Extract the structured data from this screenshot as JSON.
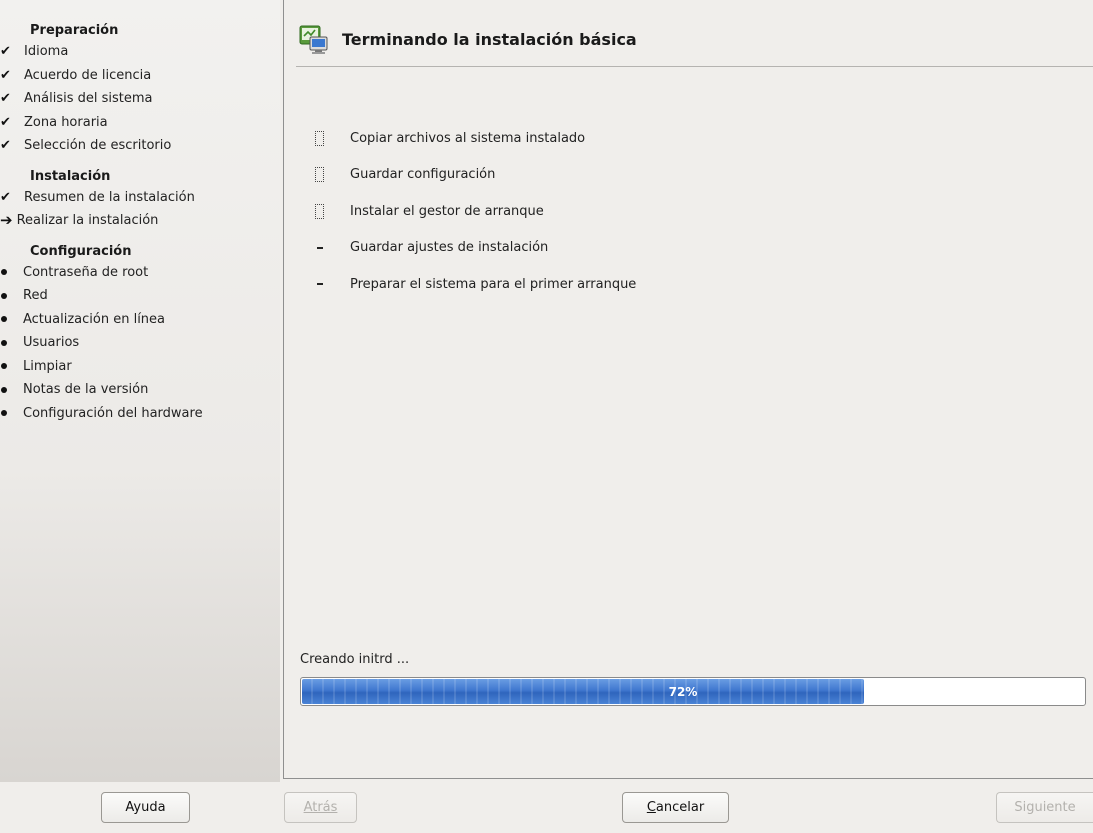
{
  "sidebar": {
    "sections": [
      {
        "title": "Preparación",
        "steps": [
          {
            "label": "Idioma",
            "state": "done",
            "icon": "check-icon"
          },
          {
            "label": "Acuerdo de licencia",
            "state": "done",
            "icon": "check-icon"
          },
          {
            "label": "Análisis del sistema",
            "state": "done",
            "icon": "check-icon"
          },
          {
            "label": "Zona horaria",
            "state": "done",
            "icon": "check-icon"
          },
          {
            "label": "Selección de escritorio",
            "state": "done",
            "icon": "check-icon"
          }
        ]
      },
      {
        "title": "Instalación",
        "steps": [
          {
            "label": "Resumen de la instalación",
            "state": "done",
            "icon": "check-icon"
          },
          {
            "label": "Realizar la instalación",
            "state": "current",
            "icon": "arrow-right-icon"
          }
        ]
      },
      {
        "title": "Configuración",
        "steps": [
          {
            "label": "Contraseña de root",
            "state": "pending",
            "icon": "bullet-icon"
          },
          {
            "label": "Red",
            "state": "pending",
            "icon": "bullet-icon"
          },
          {
            "label": "Actualización en línea",
            "state": "pending",
            "icon": "bullet-icon"
          },
          {
            "label": "Usuarios",
            "state": "pending",
            "icon": "bullet-icon"
          },
          {
            "label": "Limpiar",
            "state": "pending",
            "icon": "bullet-icon"
          },
          {
            "label": "Notas de la versión",
            "state": "pending",
            "icon": "bullet-icon"
          },
          {
            "label": "Configuración del hardware",
            "state": "pending",
            "icon": "bullet-icon"
          }
        ]
      }
    ]
  },
  "main": {
    "title": "Terminando la instalación básica",
    "title_icon": "install-computer-icon",
    "tasks": [
      {
        "label": "Copiar archivos al sistema instalado",
        "state": "in-progress"
      },
      {
        "label": "Guardar configuración",
        "state": "in-progress"
      },
      {
        "label": "Instalar el gestor de arranque",
        "state": "in-progress"
      },
      {
        "label": "Guardar ajustes de instalación",
        "state": "todo"
      },
      {
        "label": "Preparar el sistema para el primer arranque",
        "state": "todo"
      }
    ],
    "status_text": "Creando initrd ...",
    "progress": {
      "percent": 72,
      "label": "72%"
    }
  },
  "buttons": {
    "help": "Ayuda",
    "back": "Atrás",
    "cancel_prefix": "C",
    "cancel_rest": "ancelar",
    "next": "Siguiente"
  },
  "colors": {
    "progress_fill": "#3f77cf",
    "background": "#f0eeeb"
  }
}
